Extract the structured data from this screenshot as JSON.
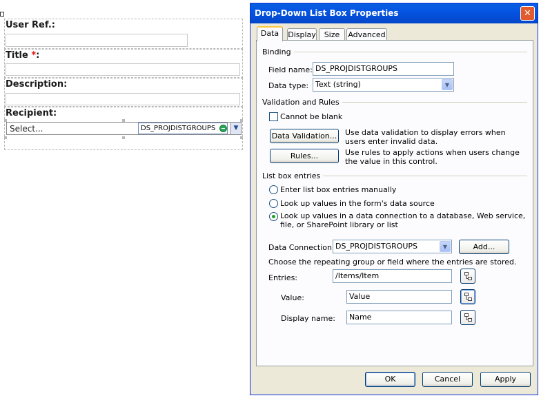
{
  "form": {
    "user_ref_label": "User Ref.:",
    "title_label": "Title ",
    "required_mark": "*",
    "title_colon": ":",
    "description_label": "Description:",
    "recipient_label": "Recipient:",
    "recipient_placeholder": "Select...",
    "recipient_binding_tag": "DS_PROJDISTGROUPS"
  },
  "dialog": {
    "title": "Drop-Down List Box Properties",
    "tabs": [
      "Data",
      "Display",
      "Size",
      "Advanced"
    ],
    "active_tab": "Data",
    "binding": {
      "group_title": "Binding",
      "field_name_label": "Field name:",
      "field_name_value": "DS_PROJDISTGROUPS",
      "data_type_label": "Data type:",
      "data_type_value": "Text (string)"
    },
    "validation": {
      "group_title": "Validation and Rules",
      "cannot_be_blank_label": "Cannot be blank",
      "cannot_be_blank_checked": false,
      "data_validation_button": "Data Validation...",
      "data_validation_desc": "Use data validation to display errors when users enter invalid data.",
      "rules_button": "Rules...",
      "rules_desc": "Use rules to apply actions when users change the value in this control."
    },
    "list_entries": {
      "group_title": "List box entries",
      "options": [
        "Enter list box entries manually",
        "Look up values in the form's data source",
        "Look up values in a data connection to a database, Web service, file, or SharePoint library or list"
      ],
      "selected_option_index": 2,
      "data_connection_label": "Data Connection:",
      "data_connection_value": "DS_PROJDISTGROUPS",
      "add_button": "Add...",
      "instruction": "Choose the repeating group or field where the entries are stored.",
      "entries_label": "Entries:",
      "entries_value": "/Items/Item",
      "value_label": "Value:",
      "value_value": "Value",
      "display_name_label": "Display name:",
      "display_name_value": "Name"
    },
    "footer": {
      "ok": "OK",
      "cancel": "Cancel",
      "apply": "Apply"
    }
  },
  "colors": {
    "title_bar": "#0554e3",
    "required": "#e01010",
    "radio_selected": "#21a121"
  }
}
